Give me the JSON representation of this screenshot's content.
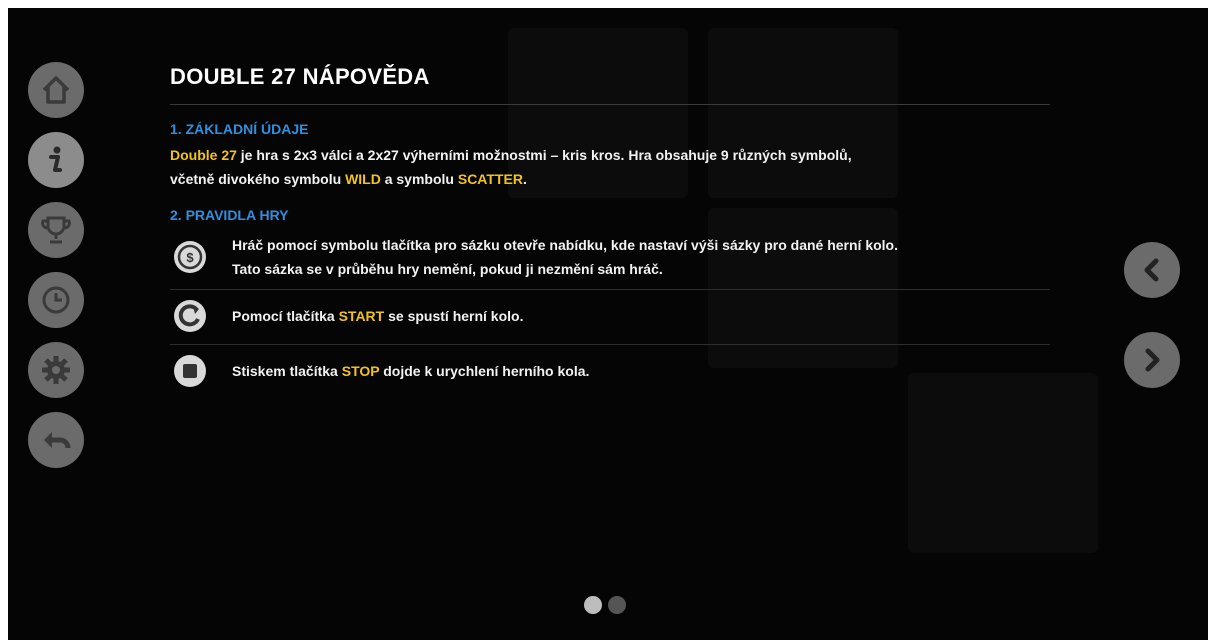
{
  "help": {
    "title": "DOUBLE 27 NÁPOVĚDA",
    "section1": {
      "heading": "1. ZÁKLADNÍ ÚDAJE",
      "game_name": "Double 27",
      "text_a": " je hra s 2x3 válci a 2x27 výherními možnostmi – kris kros. Hra obsahuje 9 různých symbolů,",
      "text_b": "včetně divokého symbolu ",
      "wild": "WILD",
      "text_c": " a symbolu ",
      "scatter": "SCATTER",
      "text_d": "."
    },
    "section2": {
      "heading": "2. PRAVIDLA HRY",
      "rules": [
        {
          "icon": "bet-coin-icon",
          "line1": "Hráč pomocí symbolu tlačítka pro sázku otevře nabídku, kde nastaví výši sázky pro dané herní kolo.",
          "line2": "Tato sázka se v průběhu hry nemění, pokud ji nezmění sám hráč."
        },
        {
          "icon": "start-spin-icon",
          "before": "Pomocí tlačítka ",
          "highlight": "START",
          "after": " se spustí herní kolo."
        },
        {
          "icon": "stop-icon",
          "before": "Stiskem tlačítka ",
          "highlight": "STOP",
          "after": " dojde k urychlení herního kola."
        }
      ]
    }
  },
  "menu": [
    "home-icon",
    "info-icon",
    "trophy-icon",
    "history-clock-icon",
    "settings-gear-icon",
    "back-arrow-icon"
  ],
  "nav": [
    "prev-page-icon",
    "next-page-icon"
  ],
  "pagination": {
    "pages": 2,
    "current": 1
  },
  "colors": {
    "accent_blue": "#2f8fe0",
    "highlight_yellow": "#f2c31a",
    "button_gray": "#6b6b6b"
  }
}
